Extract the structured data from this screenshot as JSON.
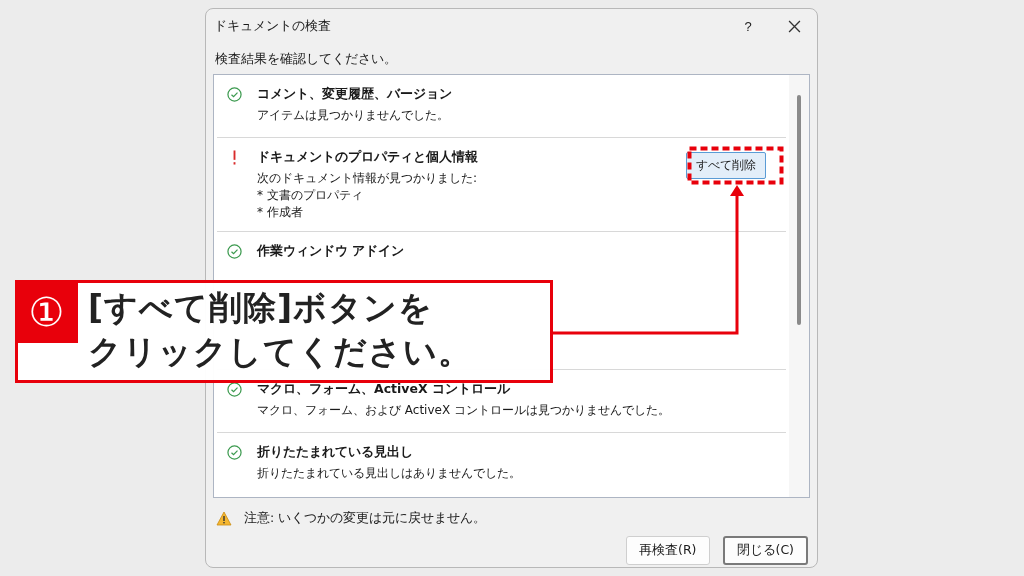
{
  "window": {
    "title": "ドキュメントの検査",
    "help": "?"
  },
  "prompt": "検査結果を確認してください。",
  "results": [
    {
      "kind": "ok",
      "title": "コメント、変更履歴、バージョン",
      "lines": [
        "アイテムは見つかりませんでした。"
      ]
    },
    {
      "kind": "found",
      "title": "ドキュメントのプロパティと個人情報",
      "lines": [
        "次のドキュメント情報が見つかりました:",
        "*  文書のプロパティ",
        "*  作成者"
      ],
      "action": "すべて削除"
    },
    {
      "kind": "ok",
      "title": "作業ウィンドウ アドイン"
    },
    {
      "kind": "ok",
      "title": "マクロ、フォーム、ActiveX コントロール",
      "lines": [
        "マクロ、フォーム、および ActiveX コントロールは見つかりませんでした。"
      ]
    },
    {
      "kind": "ok",
      "title": "折りたたまれている見出し",
      "lines": [
        "折りたたまれている見出しはありませんでした。"
      ]
    }
  ],
  "warning": "注意: いくつかの変更は元に戻せません。",
  "buttons": [
    {
      "label": "再検査(R)",
      "default": false
    },
    {
      "label": "閉じる(C)",
      "default": true
    }
  ],
  "callout": {
    "number": "①",
    "lines": [
      "[すべて削除]ボタンを",
      "クリックしてください。"
    ]
  }
}
